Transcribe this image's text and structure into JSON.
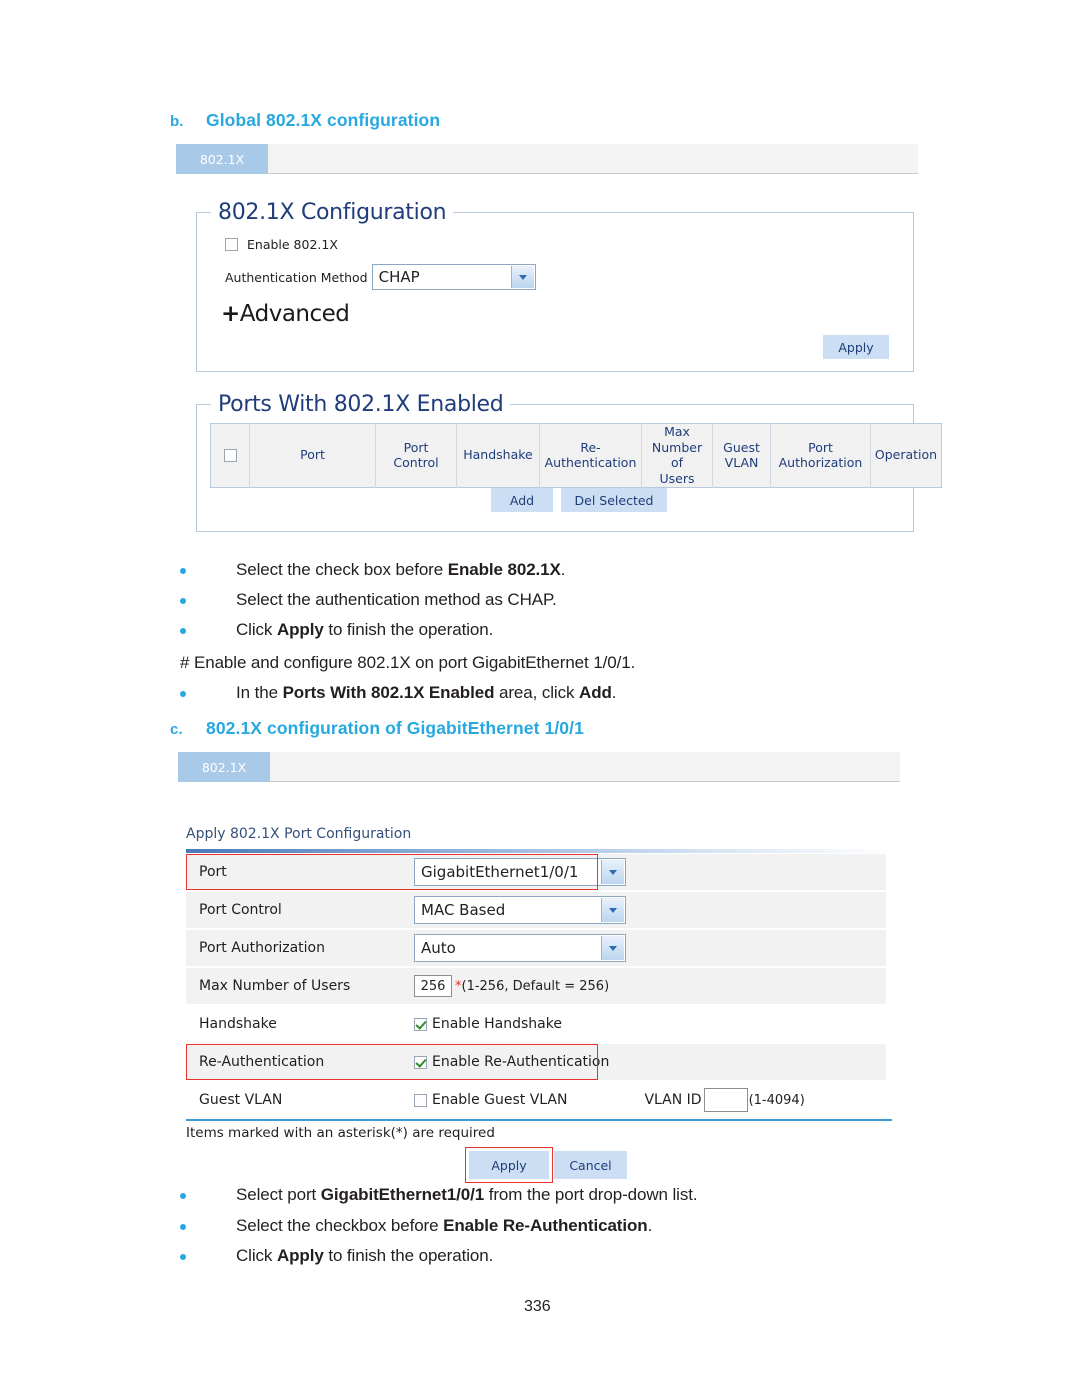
{
  "page": {
    "number": "336"
  },
  "headings": {
    "b": {
      "label": "b.",
      "text": "Global 802.1X configuration"
    },
    "c": {
      "label": "c.",
      "text": "802.1X configuration of GigabitEthernet 1/0/1"
    }
  },
  "screenshot1": {
    "tab_label": "802.1X",
    "config_panel": {
      "legend": "802.1X Configuration",
      "enable_checkbox_label": "Enable 802.1X",
      "enable_checkbox_checked": false,
      "auth_method_label": "Authentication Method",
      "auth_method_value": "CHAP",
      "advanced_label": "Advanced",
      "advanced_plus": "+",
      "apply_label": "Apply"
    },
    "ports_panel": {
      "legend": "Ports With 802.1X Enabled",
      "columns": [
        "",
        "Port",
        "Port Control",
        "Handshake",
        "Re- Authentication",
        "Max Number of Users",
        "Guest VLAN",
        "Port Authorization",
        "Operation"
      ],
      "col_port": "Port",
      "col_port_control_l1": "Port",
      "col_port_control_l2": "Control",
      "col_handshake": "Handshake",
      "col_reauth_l1": "Re-",
      "col_reauth_l2": "Authentication",
      "col_maxusers_l1": "Max",
      "col_maxusers_l2": "Number of",
      "col_maxusers_l3": "Users",
      "col_guestvlan_l1": "Guest",
      "col_guestvlan_l2": "VLAN",
      "col_portauth_l1": "Port",
      "col_portauth_l2": "Authorization",
      "col_operation": "Operation",
      "add_label": "Add",
      "del_label": "Del Selected"
    }
  },
  "bullets_mid": [
    {
      "parts": [
        {
          "t": "Select the check box before ",
          "b": false
        },
        {
          "t": "Enable 802.1X",
          "b": true
        },
        {
          "t": ".",
          "b": false
        }
      ]
    },
    {
      "parts": [
        {
          "t": "Select the authentication method as CHAP.",
          "b": false
        }
      ]
    },
    {
      "parts": [
        {
          "t": "Click ",
          "b": false
        },
        {
          "t": "Apply",
          "b": true
        },
        {
          "t": " to finish the operation.",
          "b": false
        }
      ]
    }
  ],
  "comment_mid": "# Enable and configure 802.1X on port GigabitEthernet 1/0/1.",
  "bullet_add": {
    "parts": [
      {
        "t": "In the ",
        "b": false
      },
      {
        "t": "Ports With 802.1X Enabled",
        "b": true
      },
      {
        "t": " area, click ",
        "b": false
      },
      {
        "t": "Add",
        "b": true
      },
      {
        "t": ".",
        "b": false
      }
    ]
  },
  "screenshot2": {
    "tab_label": "802.1X",
    "form_title": "Apply 802.1X Port Configuration",
    "rows": [
      {
        "name": "Port",
        "control": "select",
        "value": "GigabitEthernet1/0/1",
        "highlighted": true,
        "shaded": true
      },
      {
        "name": "Port Control",
        "control": "select",
        "value": "MAC Based",
        "highlighted": false,
        "shaded": true
      },
      {
        "name": "Port Authorization",
        "control": "select",
        "value": "Auto",
        "highlighted": false,
        "shaded": true
      },
      {
        "name": "Max Number of Users",
        "control": "text",
        "value": "256",
        "hint": "*(1-256, Default = 256)",
        "highlighted": false,
        "shaded": true
      },
      {
        "name": "Handshake",
        "control": "checkbox",
        "value": "Enable Handshake",
        "checked": true,
        "highlighted": false,
        "shaded": false
      },
      {
        "name": "Re-Authentication",
        "control": "checkbox",
        "value": "Enable Re-Authentication",
        "checked": true,
        "highlighted": true,
        "shaded": true
      },
      {
        "name": "Guest VLAN",
        "control": "checkbox",
        "value": "Enable Guest VLAN",
        "checked": false,
        "highlighted": false,
        "shaded": false
      }
    ],
    "row_port_name": "Port",
    "row_port_value": "GigabitEthernet1/0/1",
    "row_portctrl_name": "Port Control",
    "row_portctrl_value": "MAC Based",
    "row_portauth_name": "Port Authorization",
    "row_portauth_value": "Auto",
    "row_maxusers_name": "Max Number of Users",
    "row_maxusers_value": "256",
    "row_maxusers_hint": "(1-256, Default = 256)",
    "row_handshake_name": "Handshake",
    "row_handshake_value": "Enable Handshake",
    "row_reauth_name": "Re-Authentication",
    "row_reauth_value": "Enable Re-Authentication",
    "row_guestvlan_name": "Guest VLAN",
    "row_guestvlan_value": "Enable Guest VLAN",
    "vlan_id_label": "VLAN ID",
    "vlan_id_value": "",
    "vlan_id_hint": "(1-4094)",
    "required_note": "Items marked with an asterisk(*) are required",
    "apply_label": "Apply",
    "cancel_label": "Cancel"
  },
  "bullets_bottom": [
    {
      "parts": [
        {
          "t": "Select port ",
          "b": false
        },
        {
          "t": "GigabitEthernet1/0/1",
          "b": true
        },
        {
          "t": " from the port drop-down list.",
          "b": false
        }
      ]
    },
    {
      "parts": [
        {
          "t": "Select the checkbox before ",
          "b": false
        },
        {
          "t": "Enable Re-Authentication",
          "b": true
        },
        {
          "t": ".",
          "b": false
        }
      ]
    },
    {
      "parts": [
        {
          "t": "Click ",
          "b": false
        },
        {
          "t": "Apply",
          "b": true
        },
        {
          "t": " to finish the operation.",
          "b": false
        }
      ]
    }
  ],
  "colors": {
    "heading_blue": "#27a8df",
    "panel_legend_blue": "#1f3d7a",
    "tab_blue": "#a9c9e9",
    "highlight_red": "#e8342a",
    "button_blue": "#ccdef3"
  }
}
